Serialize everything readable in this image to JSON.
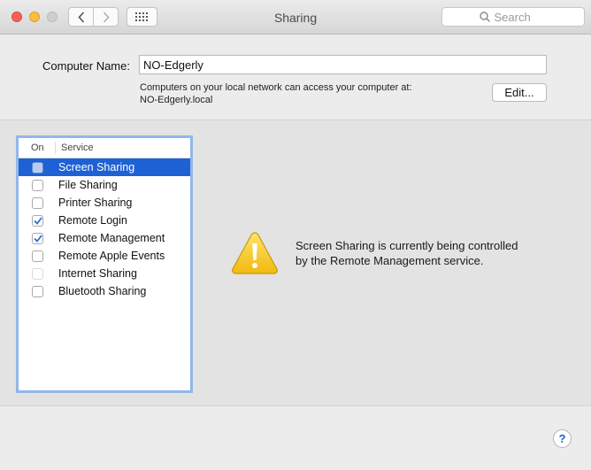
{
  "window": {
    "title": "Sharing"
  },
  "toolbar": {
    "search_placeholder": "Search"
  },
  "computer_name": {
    "label": "Computer Name:",
    "value": "NO-Edgerly",
    "note_line1": "Computers on your local network can access your computer at:",
    "note_line2": "NO-Edgerly.local",
    "edit_label": "Edit..."
  },
  "services": {
    "header_on": "On",
    "header_service": "Service",
    "items": [
      {
        "label": "Screen Sharing",
        "checked": false,
        "selected": true,
        "disabled": false
      },
      {
        "label": "File Sharing",
        "checked": false,
        "selected": false,
        "disabled": false
      },
      {
        "label": "Printer Sharing",
        "checked": false,
        "selected": false,
        "disabled": false
      },
      {
        "label": "Remote Login",
        "checked": true,
        "selected": false,
        "disabled": false
      },
      {
        "label": "Remote Management",
        "checked": true,
        "selected": false,
        "disabled": false
      },
      {
        "label": "Remote Apple Events",
        "checked": false,
        "selected": false,
        "disabled": false
      },
      {
        "label": "Internet Sharing",
        "checked": false,
        "selected": false,
        "disabled": true
      },
      {
        "label": "Bluetooth Sharing",
        "checked": false,
        "selected": false,
        "disabled": false
      }
    ]
  },
  "detail": {
    "message_line1": "Screen Sharing is currently being controlled",
    "message_line2": "by the Remote Management service."
  },
  "help": {
    "label": "?"
  },
  "colors": {
    "accent": "#1d61d4",
    "check": "#2a6fd6",
    "warning": "#f6c51c"
  }
}
